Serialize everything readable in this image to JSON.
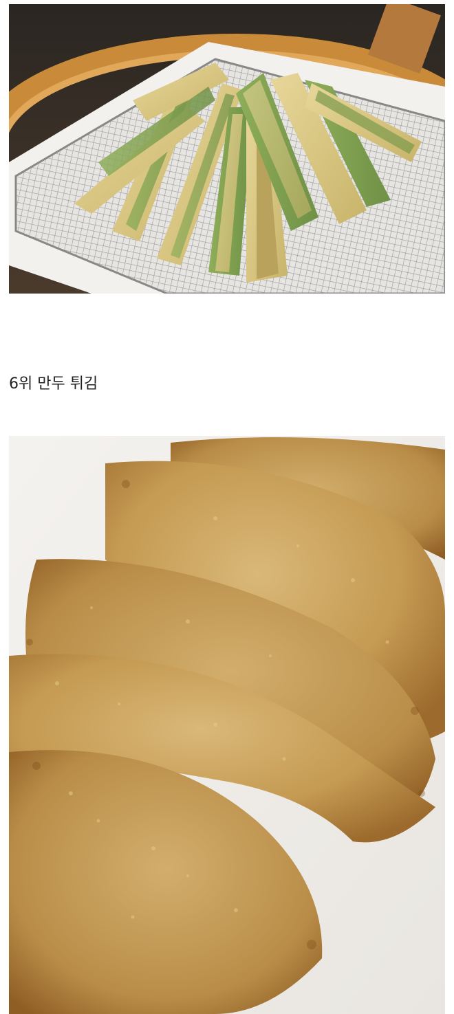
{
  "post": {
    "images": [
      {
        "subject": "vegetable-tempura-photo"
      },
      {
        "subject": "fried-dumpling-photo"
      }
    ],
    "caption": "6위 만두 튀김"
  }
}
